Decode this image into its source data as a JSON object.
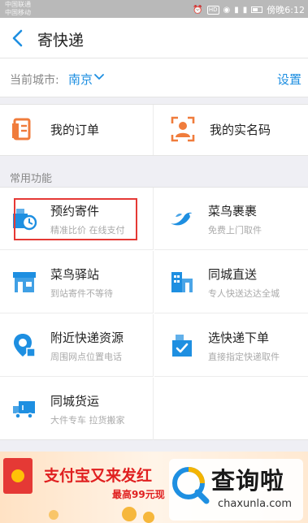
{
  "status_bar": {
    "carrier_1": "中国联通",
    "carrier_2": "中国移动",
    "time": "傍晚6:12"
  },
  "nav": {
    "title": "寄快递"
  },
  "city": {
    "label": "当前城市:",
    "value": "南京",
    "settings": "设置"
  },
  "top_actions": [
    {
      "label": "我的订单",
      "icon": "order-document-icon"
    },
    {
      "label": "我的实名码",
      "icon": "id-scan-icon"
    }
  ],
  "section": {
    "label": "常用功能"
  },
  "services": [
    {
      "title": "预约寄件",
      "subtitle": "精准比价 在线支付",
      "icon": "book-shipment-icon"
    },
    {
      "title": "菜鸟裹裹",
      "subtitle": "免费上门取件",
      "icon": "cainiao-bird-icon"
    },
    {
      "title": "菜鸟驿站",
      "subtitle": "到站寄件不等待",
      "icon": "station-icon"
    },
    {
      "title": "同城直送",
      "subtitle": "专人快送达达全城",
      "icon": "city-buildings-icon"
    },
    {
      "title": "附近快递资源",
      "subtitle": "周围网点位置电话",
      "icon": "location-pin-icon"
    },
    {
      "title": "选快递下单",
      "subtitle": "直接指定快递取件",
      "icon": "select-courier-icon"
    },
    {
      "title": "同城货运",
      "subtitle": "大件专车 拉货搬家",
      "icon": "truck-icon"
    }
  ],
  "banner": {
    "title": "支付宝又来发红",
    "subtitle": "最高99元现"
  },
  "watermark": {
    "text": "查询啦",
    "domain": "chaxunla.com"
  },
  "colors": {
    "accent": "#1e8fe1",
    "icon_orange": "#f07c3c",
    "icon_blue": "#1e8fe1",
    "highlight": "#e53935"
  }
}
